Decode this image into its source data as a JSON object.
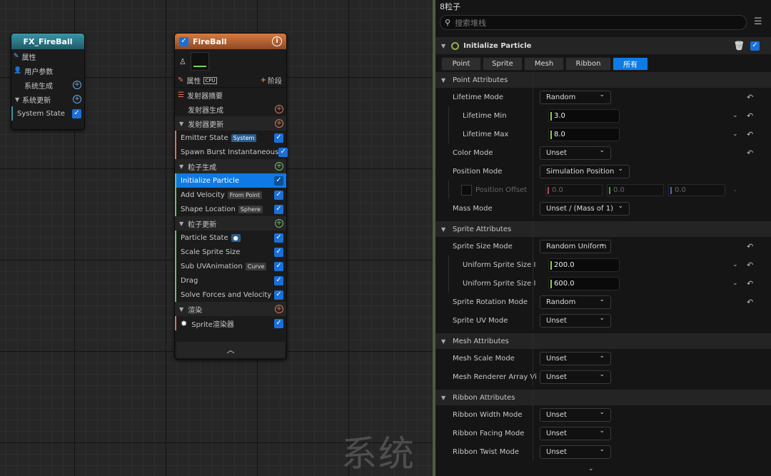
{
  "graph": {
    "watermark": "系统",
    "system_node": {
      "title": "FX_FireBall",
      "rows": [
        {
          "label": "属性",
          "icon": "pencil-icon"
        },
        {
          "label": "用户参数",
          "icon": "user-icon"
        },
        {
          "label": "系统生成",
          "action": "plus"
        },
        {
          "label": "系统更新",
          "action": "plus"
        },
        {
          "label": "System State",
          "action": "check"
        }
      ]
    },
    "emitter_node": {
      "title": "FireBall",
      "properties_label": "属性",
      "cpu_badge": "CPU",
      "stage_label": "阶段",
      "summary_label": "发射器摘要",
      "sections": [
        {
          "title": "发射器生成",
          "indent": true,
          "color": "#d07a5a",
          "items": []
        },
        {
          "title": "发射器更新",
          "color": "#d07a5a",
          "items": [
            {
              "label": "Emitter State",
              "tag": "System",
              "tag_style": "blue"
            },
            {
              "label": "Spawn Burst Instantaneous"
            }
          ]
        },
        {
          "title": "粒子生成",
          "color": "#6fc06f",
          "items": [
            {
              "label": "Initialize Particle",
              "selected": true
            },
            {
              "label": "Add Velocity",
              "tag": "From Point"
            },
            {
              "label": "Shape Location",
              "tag": "Sphere"
            }
          ]
        },
        {
          "title": "粒子更新",
          "color": "#6fc06f",
          "items": [
            {
              "label": "Particle State",
              "tag": "●",
              "tag_style": "blue"
            },
            {
              "label": "Scale Sprite Size"
            },
            {
              "label": "Sub UVAnimation",
              "tag": "Curve"
            },
            {
              "label": "Drag"
            },
            {
              "label": "Solve Forces and Velocity"
            }
          ]
        },
        {
          "title": "渲染",
          "color": "#d07a5a",
          "items": [
            {
              "label": "Sprite渲染器",
              "icon": "sparkle-icon"
            }
          ]
        }
      ]
    }
  },
  "panel": {
    "title": "8粒子",
    "search_placeholder": "搜索堆栈",
    "module_title": "Initialize Particle",
    "tabs": [
      "Point",
      "Sprite",
      "Mesh",
      "Ribbon",
      "所有"
    ],
    "active_tab": "所有",
    "sections": [
      {
        "title": "Point Attributes",
        "rows": [
          {
            "label": "Lifetime Mode",
            "kind": "dropdown",
            "value": "Random",
            "reset": true
          },
          {
            "label": "Lifetime Min",
            "kind": "number",
            "value": "3.0",
            "sub": true,
            "reset": true
          },
          {
            "label": "Lifetime Max",
            "kind": "number",
            "value": "8.0",
            "sub": true,
            "reset": true
          },
          {
            "label": "Color Mode",
            "kind": "dropdown",
            "value": "Unset",
            "reset": true
          },
          {
            "label": "Position Mode",
            "kind": "dropdown",
            "value": "Simulation Position"
          },
          {
            "label": "Position Offset",
            "kind": "vector",
            "values": [
              "0.0",
              "0.0",
              "0.0"
            ],
            "sub": true,
            "disabled": true
          },
          {
            "label": "Mass Mode",
            "kind": "dropdown",
            "value": "Unset / (Mass of 1)"
          }
        ]
      },
      {
        "title": "Sprite Attributes",
        "rows": [
          {
            "label": "Sprite Size Mode",
            "kind": "dropdown",
            "value": "Random Uniform",
            "reset": true
          },
          {
            "label": "Uniform Sprite Size I",
            "kind": "number",
            "value": "200.0",
            "sub": true,
            "reset": true
          },
          {
            "label": "Uniform Sprite Size I",
            "kind": "number",
            "value": "600.0",
            "sub": true,
            "reset": true
          },
          {
            "label": "Sprite Rotation Mode",
            "kind": "dropdown",
            "value": "Random",
            "reset": true
          },
          {
            "label": "Sprite UV Mode",
            "kind": "dropdown",
            "value": "Unset"
          }
        ]
      },
      {
        "title": "Mesh Attributes",
        "rows": [
          {
            "label": "Mesh Scale Mode",
            "kind": "dropdown",
            "value": "Unset"
          },
          {
            "label": "Mesh Renderer Array Vi",
            "kind": "dropdown",
            "value": "Unset"
          }
        ]
      },
      {
        "title": "Ribbon Attributes",
        "rows": [
          {
            "label": "Ribbon Width Mode",
            "kind": "dropdown",
            "value": "Unset"
          },
          {
            "label": "Ribbon Facing Mode",
            "kind": "dropdown",
            "value": "Unset"
          },
          {
            "label": "Ribbon Twist Mode",
            "kind": "dropdown",
            "value": "Unset"
          }
        ]
      }
    ]
  },
  "colors": {
    "accent": "#0f7ae5",
    "system_header": "#2f7f8f",
    "emitter_header": "#c0683a",
    "value_marker": "#7fd54a"
  }
}
